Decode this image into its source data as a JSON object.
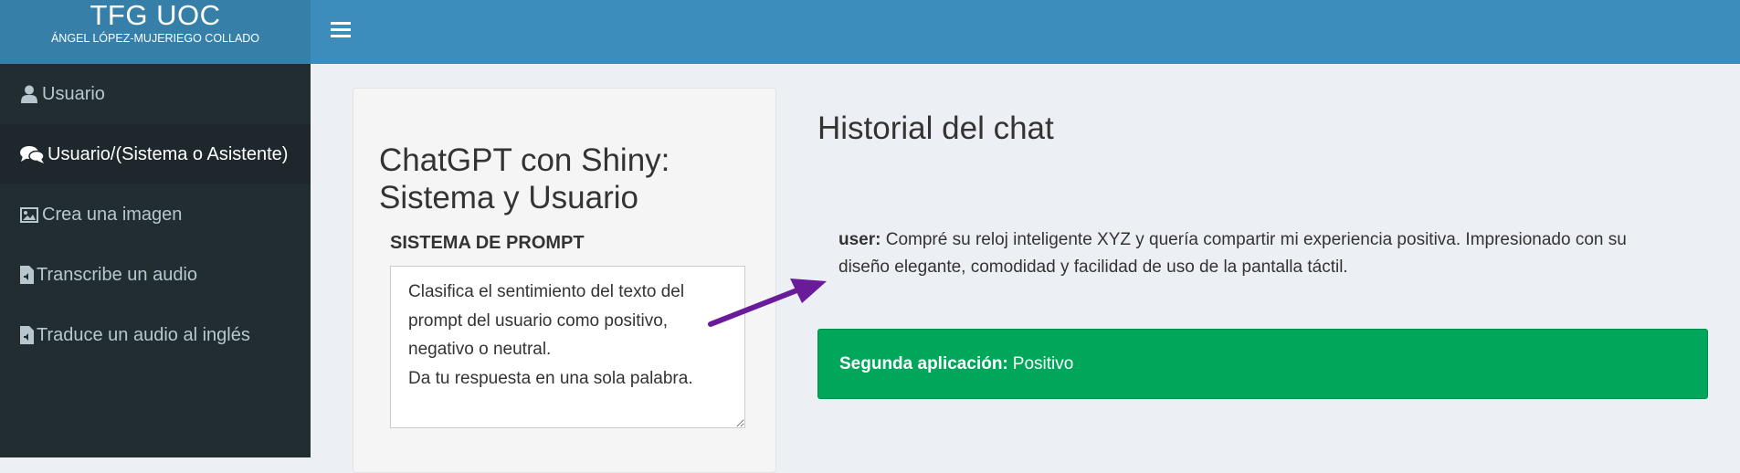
{
  "header": {
    "app_title": "TFG UOC",
    "author": "ÁNGEL LÓPEZ-MUJERIEGO COLLADO",
    "menu_icon": "hamburger-icon"
  },
  "sidebar": {
    "items": [
      {
        "label": "Usuario",
        "icon": "user-icon",
        "active": false
      },
      {
        "label": "Usuario/(Sistema o Asistente)",
        "icon": "comments-icon",
        "active": true
      },
      {
        "label": "Crea una imagen",
        "icon": "image-icon",
        "active": false
      },
      {
        "label": "Transcribe un audio",
        "icon": "file-audio-icon",
        "active": false
      },
      {
        "label": "Traduce un audio al inglés",
        "icon": "file-audio-icon",
        "active": false
      }
    ]
  },
  "left_panel": {
    "title": "ChatGPT con Shiny: Sistema y Usuario",
    "prompt_label": "SISTEMA DE PROMPT",
    "prompt_value": "Clasifica el sentimiento del texto del prompt del usuario como positivo, negativo o neutral.\nDa tu respuesta en una sola palabra."
  },
  "chat": {
    "title": "Historial del chat",
    "user_label": "user:",
    "user_text": "Compré su reloj inteligente XYZ y quería compartir mi experiencia positiva. Impresionado con su diseño elegante, comodidad y facilidad de uso de la pantalla táctil.",
    "answer_label": "Segunda aplicación:",
    "answer_text": "Positivo"
  },
  "colors": {
    "header_logo": "#367fa9",
    "header_bar": "#3c8dbc",
    "sidebar": "#222d32",
    "success": "#00a65a",
    "arrow": "#6a1b9a"
  }
}
